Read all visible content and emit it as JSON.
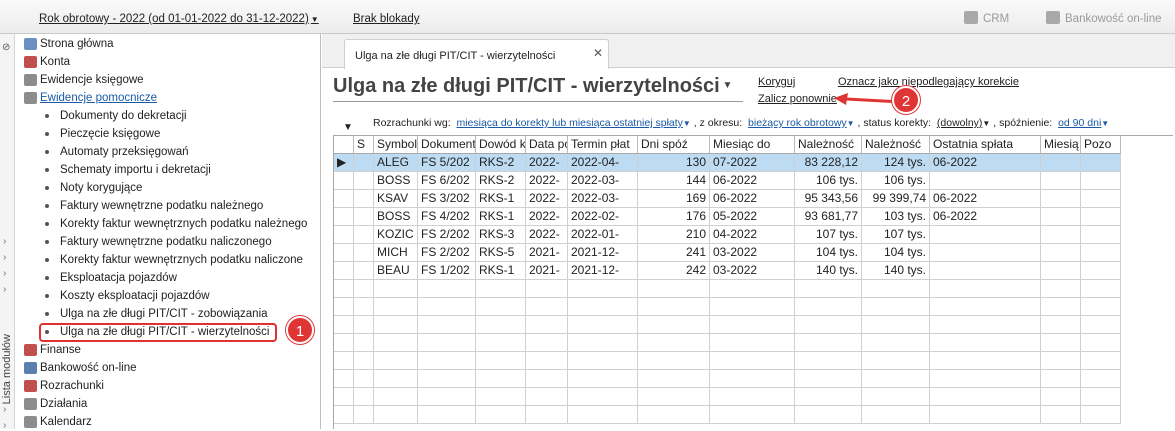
{
  "topbar": {
    "fiscal_year": "Rok obrotowy - 2022  (od 01-01-2022 do 31-12-2022)",
    "lock": "Brak blokady",
    "crm": "CRM",
    "bank": "Bankowość on-line"
  },
  "strip_label": "Lista modułów",
  "nav": [
    {
      "label": "Strona główna",
      "level": 0,
      "color": "#6a8fc0"
    },
    {
      "label": "Konta",
      "level": 0,
      "color": "#c0504d"
    },
    {
      "label": "Ewidencje księgowe",
      "level": 0,
      "color": "#8c8c8c"
    },
    {
      "label": "Ewidencje pomocnicze",
      "level": 0,
      "color": "#8c8c8c",
      "link": true
    },
    {
      "label": "Dokumenty do dekretacji",
      "level": 1
    },
    {
      "label": "Pieczęcie księgowe",
      "level": 1
    },
    {
      "label": "Automaty przeksięgowań",
      "level": 1
    },
    {
      "label": "Schematy importu i dekretacji",
      "level": 1
    },
    {
      "label": "Noty korygujące",
      "level": 1
    },
    {
      "label": "Faktury wewnętrzne podatku należnego",
      "level": 1
    },
    {
      "label": "Korekty faktur wewnętrznych podatku należnego",
      "level": 1
    },
    {
      "label": "Faktury wewnętrzne podatku naliczonego",
      "level": 1
    },
    {
      "label": "Korekty faktur wewnętrznych podatku naliczone",
      "level": 1
    },
    {
      "label": "Eksploatacja pojazdów",
      "level": 1
    },
    {
      "label": "Koszty eksploatacji pojazdów",
      "level": 1
    },
    {
      "label": "Ulga na złe długi PIT/CIT - zobowiązania",
      "level": 1
    },
    {
      "label": "Ulga na złe długi PIT/CIT - wierzytelności",
      "level": 1,
      "selected": true
    },
    {
      "label": "Finanse",
      "level": 0,
      "color": "#c0504d"
    },
    {
      "label": "Bankowość on-line",
      "level": 0,
      "color": "#5b7fb0"
    },
    {
      "label": "Rozrachunki",
      "level": 0,
      "color": "#c0504d"
    },
    {
      "label": "Działania",
      "level": 0,
      "color": "#8c8c8c"
    },
    {
      "label": "Kalendarz",
      "level": 0,
      "color": "#8c8c8c"
    }
  ],
  "badges": {
    "one": "1",
    "two": "2"
  },
  "tab": {
    "label": "Ulga na złe długi PIT/CIT - wierzytelności",
    "close": "✕"
  },
  "title": "Ulga na złe długi PIT/CIT - wierzytelności",
  "actions": {
    "korygui": "Koryguj",
    "mark": "Oznacz jako niepodlegający korekcie",
    "reapply": "Zalicz ponownie"
  },
  "filter": {
    "prefix": "Rozrachunki wg:",
    "basis": "miesiąca do korekty lub miesiąca ostatniej spłaty",
    "period_label": ", z okresu:",
    "period": "bieżący rok obrotowy",
    "status_label": ", status korekty:",
    "status": "(dowolny)",
    "delay_label": ", spóźnienie:",
    "delay": "od 90 dni"
  },
  "columns": [
    "",
    "S",
    "Symbol",
    "Dokument",
    "Dowód k",
    "Data po",
    "Termin płat",
    "Dni spóź",
    "Miesiąc do",
    "Należność",
    "Należność",
    "Ostatnia spłata",
    "Miesią",
    "Pozo"
  ],
  "rows": [
    [
      "▶",
      "",
      "ALEG",
      "FS 5/202",
      "RKS-2",
      "2022-",
      "2022-04-",
      "130",
      "07-2022",
      "83 228,12",
      "124 tys.",
      "06-2022",
      "",
      ""
    ],
    [
      "",
      "",
      "BOSS",
      "FS 6/202",
      "RKS-2",
      "2022-",
      "2022-03-",
      "144",
      "06-2022",
      "106 tys.",
      "106 tys.",
      "",
      "",
      ""
    ],
    [
      "",
      "",
      "KSAV",
      "FS 3/202",
      "RKS-1",
      "2022-",
      "2022-03-",
      "169",
      "06-2022",
      "95 343,56",
      "99 399,74",
      "06-2022",
      "",
      ""
    ],
    [
      "",
      "",
      "BOSS",
      "FS 4/202",
      "RKS-1",
      "2022-",
      "2022-02-",
      "176",
      "05-2022",
      "93 681,77",
      "103 tys.",
      "06-2022",
      "",
      ""
    ],
    [
      "",
      "",
      "KOZIC",
      "FS 2/202",
      "RKS-3",
      "2022-",
      "2022-01-",
      "210",
      "04-2022",
      "107 tys.",
      "107 tys.",
      "",
      "",
      ""
    ],
    [
      "",
      "",
      "MICH",
      "FS 2/202",
      "RKS-5",
      "2021-",
      "2021-12-",
      "241",
      "03-2022",
      "104 tys.",
      "104 tys.",
      "",
      "",
      ""
    ],
    [
      "",
      "",
      "BEAU",
      "FS 1/202",
      "RKS-1",
      "2021-",
      "2021-12-",
      "242",
      "03-2022",
      "140 tys.",
      "140 tys.",
      "",
      "",
      ""
    ]
  ]
}
